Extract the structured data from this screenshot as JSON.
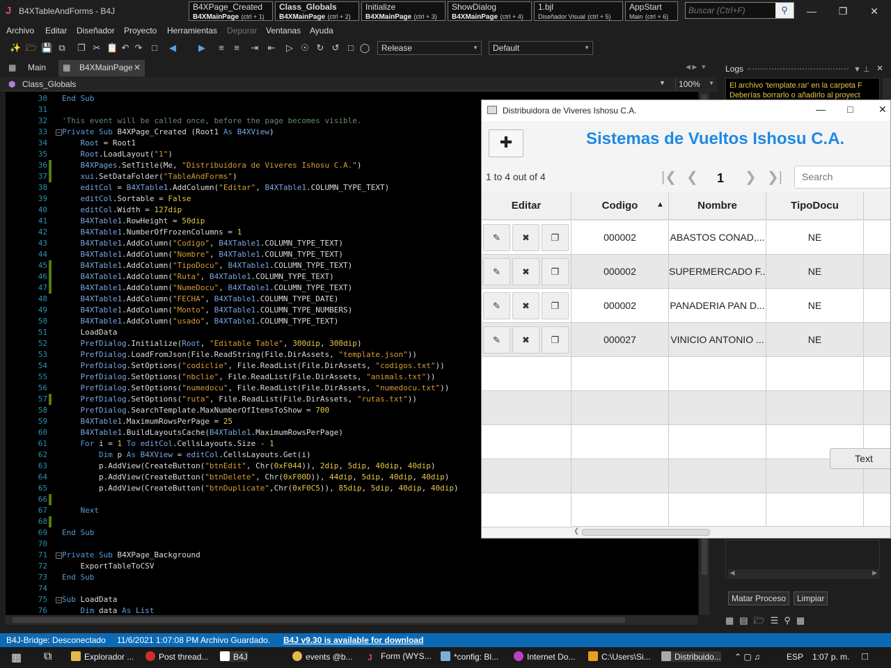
{
  "window": {
    "title": "B4XTableAndForms - B4J"
  },
  "quick_tabs": [
    {
      "name": "B4XPage_Created",
      "module": "B4XMainPage",
      "shortcut": "(ctrl + 1)"
    },
    {
      "name": "Class_Globals",
      "module": "B4XMainPage",
      "shortcut": "(ctrl + 2)"
    },
    {
      "name": "Initialize",
      "module": "B4XMainPage",
      "shortcut": "(ctrl + 3)"
    },
    {
      "name": "ShowDialog",
      "module": "B4XMainPage",
      "shortcut": "(ctrl + 4)"
    },
    {
      "name": "1.bjl",
      "module": "Diseñador Visual",
      "shortcut": "(ctrl + 5)"
    },
    {
      "name": "AppStart",
      "module": "Main",
      "shortcut": "(ctrl + 6)"
    }
  ],
  "search": {
    "placeholder": "Buscar (Ctrl+F)"
  },
  "menu": [
    "Archivo",
    "Editar",
    "Diseñador",
    "Proyecto",
    "Herramientas",
    "Depurar",
    "Ventanas",
    "Ayuda"
  ],
  "toolbar": {
    "build_config": "Release",
    "platform": "Default"
  },
  "doc_tabs": {
    "main": "Main",
    "active": "B4XMainPage"
  },
  "nav": {
    "member": "Class_Globals",
    "zoom": "100%"
  },
  "logs": {
    "title": "Logs",
    "line1": "El archivo 'template.rar' en la carpeta F",
    "line2": "Deberías borrarlo o añadirlo al proyect",
    "kill_button": "Matar Proceso",
    "clear_button": "Limpiar"
  },
  "code_lines": [
    {
      "n": "30",
      "html": "<span class=\"kw\">End Sub</span>"
    },
    {
      "n": "31",
      "html": ""
    },
    {
      "n": "32",
      "html": "<span class=\"cm\">'This event will be called once, before the page becomes visible.</span>"
    },
    {
      "n": "33",
      "html": "<span class=\"kw\">Private Sub</span> B4XPage_Created (Root1 <span class=\"kw\">As</span> <span class=\"obj\">B4XView</span>)"
    },
    {
      "n": "34",
      "html": "    <span class=\"obj\">Root</span> = Root1"
    },
    {
      "n": "35",
      "html": "    <span class=\"obj\">Root</span>.LoadLayout(<span class=\"str\">\"1\"</span>)"
    },
    {
      "n": "36",
      "html": "    <span class=\"obj\">B4XPages</span>.SetTitle(Me, <span class=\"str\">\"Distribuidora de Viveres Ishosu C.A.\"</span>)"
    },
    {
      "n": "37",
      "html": "    <span class=\"obj\">xui</span>.SetDataFolder(<span class=\"str\">\"TableAndForms\"</span>)"
    },
    {
      "n": "38",
      "html": "    <span class=\"obj\">editCol</span> = <span class=\"obj\">B4XTable1</span>.AddColumn(<span class=\"str\">\"Editar\"</span>, <span class=\"obj\">B4XTable1</span>.COLUMN_TYPE_TEXT)"
    },
    {
      "n": "39",
      "html": "    <span class=\"obj\">editCol</span>.Sortable = <span class=\"num\">False</span>"
    },
    {
      "n": "40",
      "html": "    <span class=\"obj\">editCol</span>.Width = <span class=\"num\">127dip</span>"
    },
    {
      "n": "41",
      "html": "    <span class=\"obj\">B4XTable1</span>.RowHeight = <span class=\"num\">50dip</span>"
    },
    {
      "n": "42",
      "html": "    <span class=\"obj\">B4XTable1</span>.NumberOfFrozenColumns = <span class=\"num\">1</span>"
    },
    {
      "n": "43",
      "html": "    <span class=\"obj\">B4XTable1</span>.AddColumn(<span class=\"str\">\"Codigo\"</span>, <span class=\"obj\">B4XTable1</span>.COLUMN_TYPE_TEXT)"
    },
    {
      "n": "44",
      "html": "    <span class=\"obj\">B4XTable1</span>.AddColumn(<span class=\"str\">\"Nombre\"</span>, <span class=\"obj\">B4XTable1</span>.COLUMN_TYPE_TEXT)"
    },
    {
      "n": "45",
      "html": "    <span class=\"obj\">B4XTable1</span>.AddColumn(<span class=\"str\">\"TipoDocu\"</span>, <span class=\"obj\">B4XTable1</span>.COLUMN_TYPE_TEXT)"
    },
    {
      "n": "46",
      "html": "    <span class=\"obj\">B4XTable1</span>.AddColumn(<span class=\"str\">\"Ruta\"</span>, <span class=\"obj\">B4XTable1</span>.COLUMN_TYPE_TEXT)"
    },
    {
      "n": "47",
      "html": "    <span class=\"obj\">B4XTable1</span>.AddColumn(<span class=\"str\">\"NumeDocu\"</span>, <span class=\"obj\">B4XTable1</span>.COLUMN_TYPE_TEXT)"
    },
    {
      "n": "48",
      "html": "    <span class=\"obj\">B4XTable1</span>.AddColumn(<span class=\"str\">\"FECHA\"</span>, <span class=\"obj\">B4XTable1</span>.COLUMN_TYPE_DATE)"
    },
    {
      "n": "49",
      "html": "    <span class=\"obj\">B4XTable1</span>.AddColumn(<span class=\"str\">\"Monto\"</span>, <span class=\"obj\">B4XTable1</span>.COLUMN_TYPE_NUMBERS)"
    },
    {
      "n": "50",
      "html": "    <span class=\"obj\">B4XTable1</span>.AddColumn(<span class=\"str\">\"usado\"</span>, <span class=\"obj\">B4XTable1</span>.COLUMN_TYPE_TEXT)"
    },
    {
      "n": "51",
      "html": "    LoadData"
    },
    {
      "n": "52",
      "html": "    <span class=\"obj\">PrefDialog</span>.Initialize(<span class=\"obj\">Root</span>, <span class=\"str\">\"Editable Table\"</span>, <span class=\"num\">300dip</span>, <span class=\"num\">300dip</span>)"
    },
    {
      "n": "53",
      "html": "    <span class=\"obj\">PrefDialog</span>.LoadFromJson(File.ReadString(File.DirAssets, <span class=\"str\">\"template.json\"</span>))"
    },
    {
      "n": "54",
      "html": "    <span class=\"obj\">PrefDialog</span>.SetOptions(<span class=\"str\">\"codiclie\"</span>, File.ReadList(File.DirAssets, <span class=\"str\">\"codigos.txt\"</span>))"
    },
    {
      "n": "55",
      "html": "    <span class=\"obj\">PrefDialog</span>.SetOptions(<span class=\"str\">\"nbclie\"</span>, File.ReadList(File.DirAssets, <span class=\"str\">\"animals.txt\"</span>))"
    },
    {
      "n": "56",
      "html": "    <span class=\"obj\">PrefDialog</span>.SetOptions(<span class=\"str\">\"numedocu\"</span>, File.ReadList(File.DirAssets, <span class=\"str\">\"numedocu.txt\"</span>))"
    },
    {
      "n": "57",
      "html": "    <span class=\"obj\">PrefDialog</span>.SetOptions(<span class=\"str\">\"ruta\"</span>, File.ReadList(File.DirAssets, <span class=\"str\">\"rutas.txt\"</span>))"
    },
    {
      "n": "58",
      "html": "    <span class=\"obj\">PrefDialog</span>.SearchTemplate.MaxNumberOfItemsToShow = <span class=\"num\">700</span>"
    },
    {
      "n": "59",
      "html": "    <span class=\"obj\">B4XTable1</span>.MaximumRowsPerPage = <span class=\"num\">25</span>"
    },
    {
      "n": "60",
      "html": "    <span class=\"obj\">B4XTable1</span>.BuildLayoutsCache(<span class=\"obj\">B4XTable1</span>.MaximumRowsPerPage)"
    },
    {
      "n": "61",
      "html": "    <span class=\"kw\">For</span> i = <span class=\"num\">1</span> <span class=\"kw\">To</span> <span class=\"obj\">editCol</span>.CellsLayouts.Size - <span class=\"num\">1</span>"
    },
    {
      "n": "62",
      "html": "        <span class=\"kw\">Dim</span> p <span class=\"kw\">As</span> <span class=\"obj\">B4XView</span> = <span class=\"obj\">editCol</span>.CellsLayouts.Get(i)"
    },
    {
      "n": "63",
      "html": "        p.AddView(CreateButton(<span class=\"str\">\"btnEdit\"</span>, Chr(<span class=\"num\">0xF044</span>)), <span class=\"num\">2dip</span>, <span class=\"num\">5dip</span>, <span class=\"num\">40dip</span>, <span class=\"num\">40dip</span>)"
    },
    {
      "n": "64",
      "html": "        p.AddView(CreateButton(<span class=\"str\">\"btnDelete\"</span>, Chr(<span class=\"num\">0xF00D</span>)), <span class=\"num\">44dip</span>, <span class=\"num\">5dip</span>, <span class=\"num\">40dip</span>, <span class=\"num\">40dip</span>)"
    },
    {
      "n": "65",
      "html": "        p.AddView(CreateButton(<span class=\"str\">\"btnDuplicate\"</span>,Chr(<span class=\"num\">0xF0C5</span>)), <span class=\"num\">85dip</span>, <span class=\"num\">5dip</span>, <span class=\"num\">40dip</span>, <span class=\"num\">40dip</span>)"
    },
    {
      "n": "66",
      "html": ""
    },
    {
      "n": "67",
      "html": "    <span class=\"kw\">Next</span>"
    },
    {
      "n": "68",
      "html": ""
    },
    {
      "n": "69",
      "html": "<span class=\"kw\">End Sub</span>"
    },
    {
      "n": "70",
      "html": ""
    },
    {
      "n": "71",
      "html": "<span class=\"kw\">Private Sub</span> B4XPage_Background"
    },
    {
      "n": "72",
      "html": "    ExportTableToCSV"
    },
    {
      "n": "73",
      "html": "<span class=\"kw\">End Sub</span>"
    },
    {
      "n": "74",
      "html": ""
    },
    {
      "n": "75",
      "html": "<span class=\"kw\">Sub</span> LoadData"
    },
    {
      "n": "76",
      "html": "    <span class=\"kw\">Dim</span> data <span class=\"kw\">As</span> <span class=\"obj\">List</span>"
    }
  ],
  "popup": {
    "title": "Distribuidora de Viveres Ishosu C.A.",
    "app_title": "Sistemas de Vueltos Ishosu C.A.",
    "page_info": "1 to 4 out of 4",
    "page_number": "1",
    "search_placeholder": "Search",
    "columns": [
      "Editar",
      "Codigo",
      "Nombre",
      "TipoDocu"
    ],
    "rows": [
      {
        "codigo": "000002",
        "nombre": "ABASTOS CONAD,...",
        "tipo": "NE"
      },
      {
        "codigo": "000002",
        "nombre": "SUPERMERCADO F...",
        "tipo": "NE"
      },
      {
        "codigo": "000002",
        "nombre": "PANADERIA PAN D...",
        "tipo": "NE"
      },
      {
        "codigo": "000027",
        "nombre": "VINICIO ANTONIO ...",
        "tipo": "NE"
      }
    ],
    "text_button": "Text"
  },
  "status": {
    "bridge": "B4J-Bridge: Desconectado",
    "datetime": "11/6/2021 1:07:08 PM",
    "saved": "Archivo Guardado.",
    "update": "B4J v9.30 is available for download"
  },
  "taskbar": {
    "items": [
      "Explorador ...",
      "Post thread...",
      "B4J",
      "events @b...",
      "Form (WYS...",
      "*config: Bl...",
      "Internet Do...",
      "C:\\Users\\Si...",
      "Distribuido..."
    ],
    "lang": "ESP",
    "time": "1:07 p. m."
  }
}
